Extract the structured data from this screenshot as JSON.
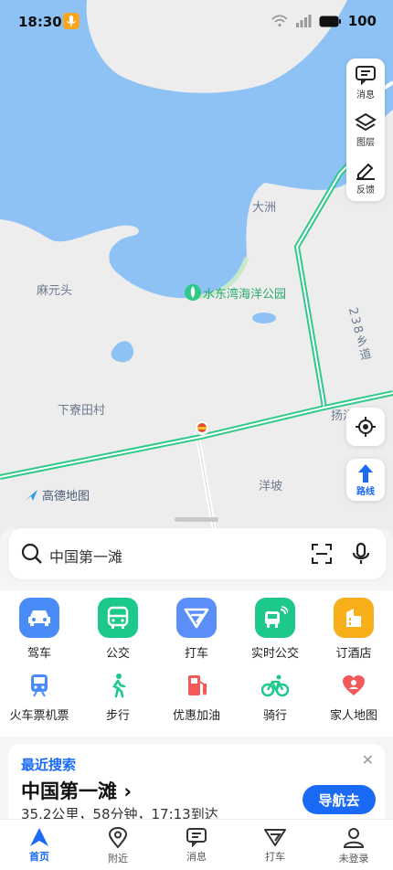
{
  "status": {
    "time": "18:30",
    "battery": "100"
  },
  "map": {
    "labels": {
      "dazhou": "大洲",
      "mayuantou": "麻元头",
      "park": "水东湾海洋公园",
      "xiazhaitian": "下寮田村",
      "yangpo": "洋坡",
      "yang_road": "扬洋",
      "road238": "238乡道"
    },
    "brand": "高德地图",
    "side_tools": [
      {
        "label": "消息",
        "icon": "message-icon"
      },
      {
        "label": "图层",
        "icon": "layers-icon"
      },
      {
        "label": "反馈",
        "icon": "feedback-icon"
      }
    ],
    "route_button": "路线"
  },
  "search": {
    "text": "中国第一滩"
  },
  "quick_row1": [
    {
      "label": "驾车",
      "icon": "car-icon",
      "color": "#4a8cf7"
    },
    {
      "label": "公交",
      "icon": "bus-icon",
      "color": "#1cc98a"
    },
    {
      "label": "打车",
      "icon": "taxi-icon",
      "color": "#5b8ef8"
    },
    {
      "label": "实时公交",
      "icon": "realtime-bus-icon",
      "color": "#1cc98a"
    },
    {
      "label": "订酒店",
      "icon": "hotel-icon",
      "color": "#f7b01a"
    }
  ],
  "quick_row2": [
    {
      "label": "火车票机票",
      "icon": "train-icon",
      "color": "#4a8cf7"
    },
    {
      "label": "步行",
      "icon": "walk-icon",
      "color": "#1cc98a"
    },
    {
      "label": "优惠加油",
      "icon": "fuel-icon",
      "color": "#f25a5a"
    },
    {
      "label": "骑行",
      "icon": "bike-icon",
      "color": "#1cc98a"
    },
    {
      "label": "家人地图",
      "icon": "family-map-icon",
      "color": "#f25a5a"
    }
  ],
  "recent": {
    "header": "最近搜索",
    "title": "中国第一滩",
    "chevron": "›",
    "subtitle": "35.2公里，58分钟，17:13到达",
    "nav_button": "导航去",
    "close": "✕"
  },
  "tabs": [
    {
      "label": "首页",
      "icon": "home-icon",
      "active": true
    },
    {
      "label": "附近",
      "icon": "nearby-icon",
      "active": false
    },
    {
      "label": "消息",
      "icon": "message-icon",
      "active": false
    },
    {
      "label": "打车",
      "icon": "taxi-icon",
      "active": false
    },
    {
      "label": "未登录",
      "icon": "user-icon",
      "active": false
    }
  ],
  "colors": {
    "accent": "#1a6af5",
    "water": "#8ec2f5",
    "road": "#2fc98a"
  }
}
